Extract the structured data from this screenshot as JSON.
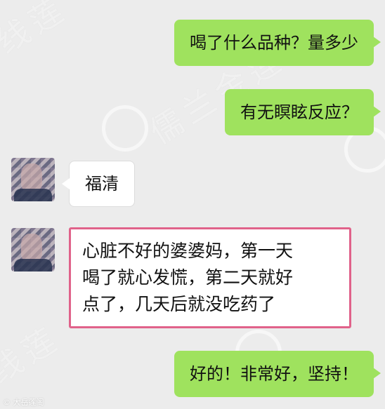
{
  "watermark": {
    "text_1": "儒兰金莲",
    "text_2": "线莲",
    "text_3": "儒兰金莲"
  },
  "messages": [
    {
      "side": "out",
      "text": "喝了什么品种？量多少"
    },
    {
      "side": "out",
      "text": "有无瞑眩反应？"
    },
    {
      "side": "in",
      "text": "福清"
    },
    {
      "side": "in",
      "lines": [
        "心脏不好的婆婆妈，第一天",
        "喝了就心发慌，第二天就好",
        "点了，几天后就没吃药了"
      ]
    },
    {
      "side": "out",
      "text": "好的！非常好，坚持！"
    }
  ],
  "footer": {
    "tag": "© 大岳莲阁"
  },
  "colors": {
    "out_bubble": "#9fe25e",
    "in_bubble": "#ffffff",
    "highlight_border": "#e0628a",
    "background": "#ececec"
  }
}
